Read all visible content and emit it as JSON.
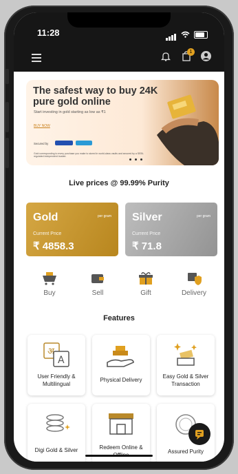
{
  "status_bar": {
    "time": "11:28"
  },
  "header": {
    "cart_badge": "1"
  },
  "banner": {
    "headline": "The safest way to buy 24K pure gold online",
    "subtext": "Start investing in gold starting as low as ₹1",
    "cta": "BUY NOW",
    "secured_by": "Secured by",
    "fine_print": "Gold corresponding to every purchase you make is stored in world-class vaults and secured by a SEBI-regulated independent trustee."
  },
  "live_prices_heading": "Live prices @ 99.99% Purity",
  "prices": [
    {
      "name": "Gold",
      "per_unit": "per gram",
      "current_label": "Current Price",
      "value": "₹ 4858.3"
    },
    {
      "name": "Silver",
      "per_unit": "per gram",
      "current_label": "Current Price",
      "value": "₹ 71.8"
    }
  ],
  "actions": [
    {
      "label": "Buy",
      "icon": "cart-gold-icon"
    },
    {
      "label": "Sell",
      "icon": "wallet-icon"
    },
    {
      "label": "Gift",
      "icon": "gift-icon"
    },
    {
      "label": "Delivery",
      "icon": "delivery-shield-icon"
    }
  ],
  "features_heading": "Features",
  "features": [
    {
      "label": "User Friendly & Multilingual",
      "icon": "language-icon"
    },
    {
      "label": "Physical Delivery",
      "icon": "hand-gold-icon"
    },
    {
      "label": "Easy Gold & Silver Transaction",
      "icon": "gold-bars-sparkle-icon"
    },
    {
      "label": "Digi Gold & Silver",
      "icon": "coins-stack-icon"
    },
    {
      "label": "Redeem Online & Offline",
      "icon": "store-icon"
    },
    {
      "label": "Assured Purity",
      "icon": "purity-badge-icon"
    }
  ],
  "colors": {
    "gold": "#c99a33",
    "silver": "#a8a8a8",
    "accent": "#e0a020",
    "header_bg": "#161616"
  }
}
